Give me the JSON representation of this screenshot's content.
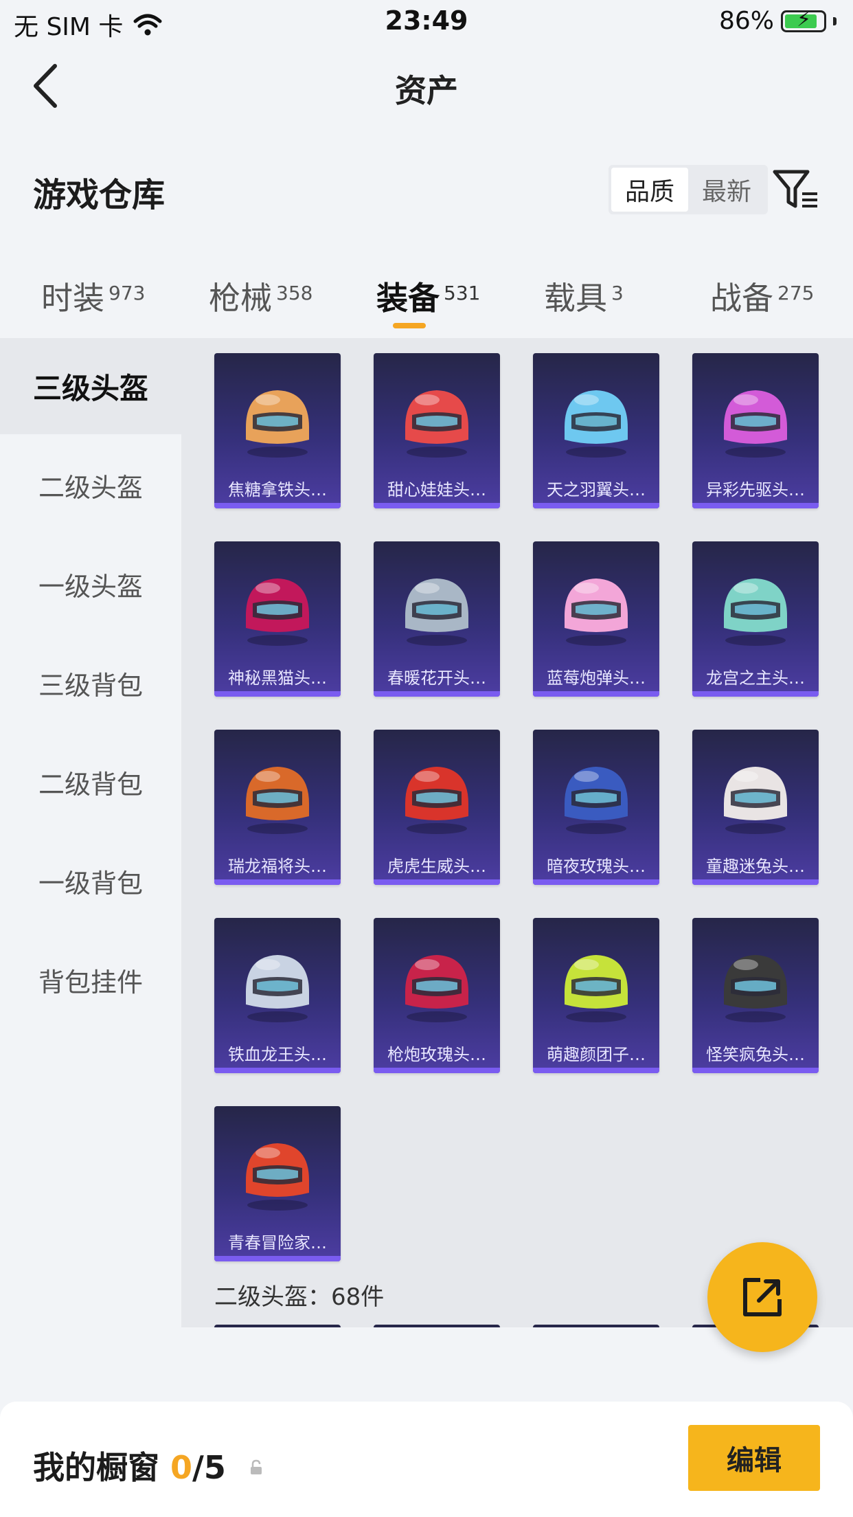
{
  "status_bar": {
    "carrier": "无 SIM 卡",
    "time": "23:49",
    "battery": "86%",
    "battery_level": 0.86
  },
  "nav": {
    "title": "资产"
  },
  "warehouse": {
    "title": "游戏仓库",
    "sort_options": [
      "品质",
      "最新"
    ],
    "active_sort": "品质"
  },
  "tabs": [
    {
      "label": "时装",
      "count": "973"
    },
    {
      "label": "枪械",
      "count": "358"
    },
    {
      "label": "装备",
      "count": "531"
    },
    {
      "label": "载具",
      "count": "3"
    },
    {
      "label": "战备",
      "count": "275"
    }
  ],
  "active_tab": "装备",
  "sidebar": {
    "items": [
      "三级头盔",
      "二级头盔",
      "一级头盔",
      "三级背包",
      "二级背包",
      "一级背包",
      "背包挂件"
    ]
  },
  "items": [
    {
      "name": "焦糖拿铁头…",
      "color": "#e8a25a"
    },
    {
      "name": "甜心娃娃头…",
      "color": "#e64a4a"
    },
    {
      "name": "天之羽翼头…",
      "color": "#6ec8f0"
    },
    {
      "name": "异彩先驱头…",
      "color": "#d35bd8"
    },
    {
      "name": "神秘黑猫头…",
      "color": "#c2185b"
    },
    {
      "name": "春暖花开头…",
      "color": "#a9b7c6"
    },
    {
      "name": "蓝莓炮弹头…",
      "color": "#f3a6d8"
    },
    {
      "name": "龙宫之主头…",
      "color": "#7fd3c7"
    },
    {
      "name": "瑞龙福将头…",
      "color": "#d9692a"
    },
    {
      "name": "虎虎生威头…",
      "color": "#d9342b"
    },
    {
      "name": "暗夜玫瑰头…",
      "color": "#3a5bc0"
    },
    {
      "name": "童趣迷兔头…",
      "color": "#e9e4e4"
    },
    {
      "name": "铁血龙王头…",
      "color": "#c9d3e3"
    },
    {
      "name": "枪炮玫瑰头…",
      "color": "#c8234a"
    },
    {
      "name": "萌趣颜团子…",
      "color": "#c6e23a"
    },
    {
      "name": "怪笑疯兔头…",
      "color": "#3a3a3a"
    },
    {
      "name": "青春冒险家…",
      "color": "#e0452c"
    }
  ],
  "section2": {
    "label": "二级头盔：68件"
  },
  "bottom": {
    "title": "我的橱窗",
    "current": "0",
    "total": "/5",
    "edit_label": "编辑"
  }
}
